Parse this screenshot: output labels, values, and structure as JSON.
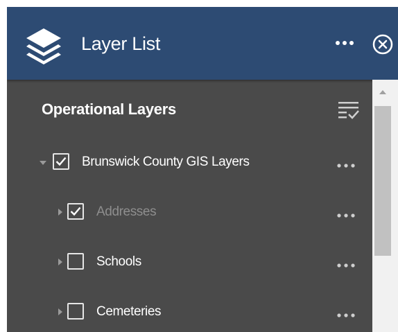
{
  "header": {
    "title": "Layer List",
    "logo_icon": "layers-icon",
    "more_icon": "more-options-icon",
    "close_icon": "close-circle-icon",
    "background_color": "#2d4b73"
  },
  "content": {
    "section_title": "Operational Layers",
    "filter_icon": "layer-filter-icon",
    "background_color": "#4a4a4a"
  },
  "layers": [
    {
      "label": "Brunswick County GIS Layers",
      "checked": true,
      "expanded": true,
      "dimmed": false,
      "level": 0
    },
    {
      "label": "Addresses",
      "checked": true,
      "expanded": false,
      "dimmed": true,
      "level": 1
    },
    {
      "label": "Schools",
      "checked": false,
      "expanded": false,
      "dimmed": false,
      "level": 1
    },
    {
      "label": "Cemeteries",
      "checked": false,
      "expanded": false,
      "dimmed": false,
      "level": 1
    }
  ]
}
